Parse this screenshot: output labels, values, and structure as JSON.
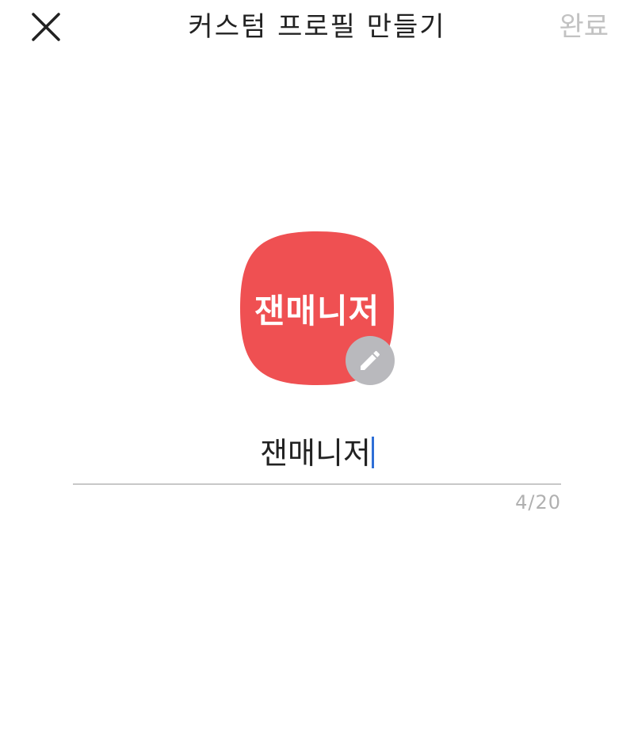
{
  "header": {
    "title": "커스텀 프로필 만들기",
    "done_label": "완료",
    "close_icon": "close-icon"
  },
  "avatar": {
    "text": "잰매니저",
    "background_color": "#ef5052",
    "edit_icon": "pencil-icon"
  },
  "name_input": {
    "value": "잰매니저",
    "counter": "4/20"
  },
  "colors": {
    "done_disabled": "#c2c2c2",
    "caret": "#2f6fd6",
    "edit_badge": "#b9b9bd"
  }
}
